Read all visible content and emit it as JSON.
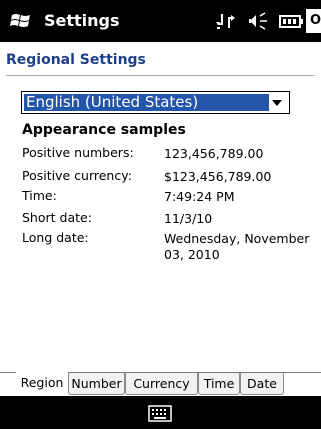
{
  "titlebar": {
    "title": "Settings",
    "ok_label": "OK",
    "icons": [
      "windows-start-icon",
      "connectivity-icon",
      "volume-icon",
      "battery-icon"
    ]
  },
  "page": {
    "heading": "Regional Settings"
  },
  "region_select": {
    "selected": "English (United States)"
  },
  "samples": {
    "heading": "Appearance samples",
    "rows": [
      {
        "label": "Positive numbers:",
        "value": "123,456,789.00"
      },
      {
        "label": "Positive currency:",
        "value": "$123,456,789.00"
      },
      {
        "label": "Time:",
        "value": "7:49:24 PM"
      },
      {
        "label": "Short date:",
        "value": "11/3/10"
      },
      {
        "label": "Long date:",
        "value": "Wednesday, November 03, 2010"
      }
    ]
  },
  "tabs": [
    {
      "label": "Region",
      "active": true
    },
    {
      "label": "Number",
      "active": false
    },
    {
      "label": "Currency",
      "active": false
    },
    {
      "label": "Time",
      "active": false
    },
    {
      "label": "Date",
      "active": false
    }
  ],
  "bottombar": {
    "icon": "keyboard-icon"
  },
  "colors": {
    "heading": "#1e3f8c",
    "selection": "#2455a8",
    "bar": "#000000"
  }
}
